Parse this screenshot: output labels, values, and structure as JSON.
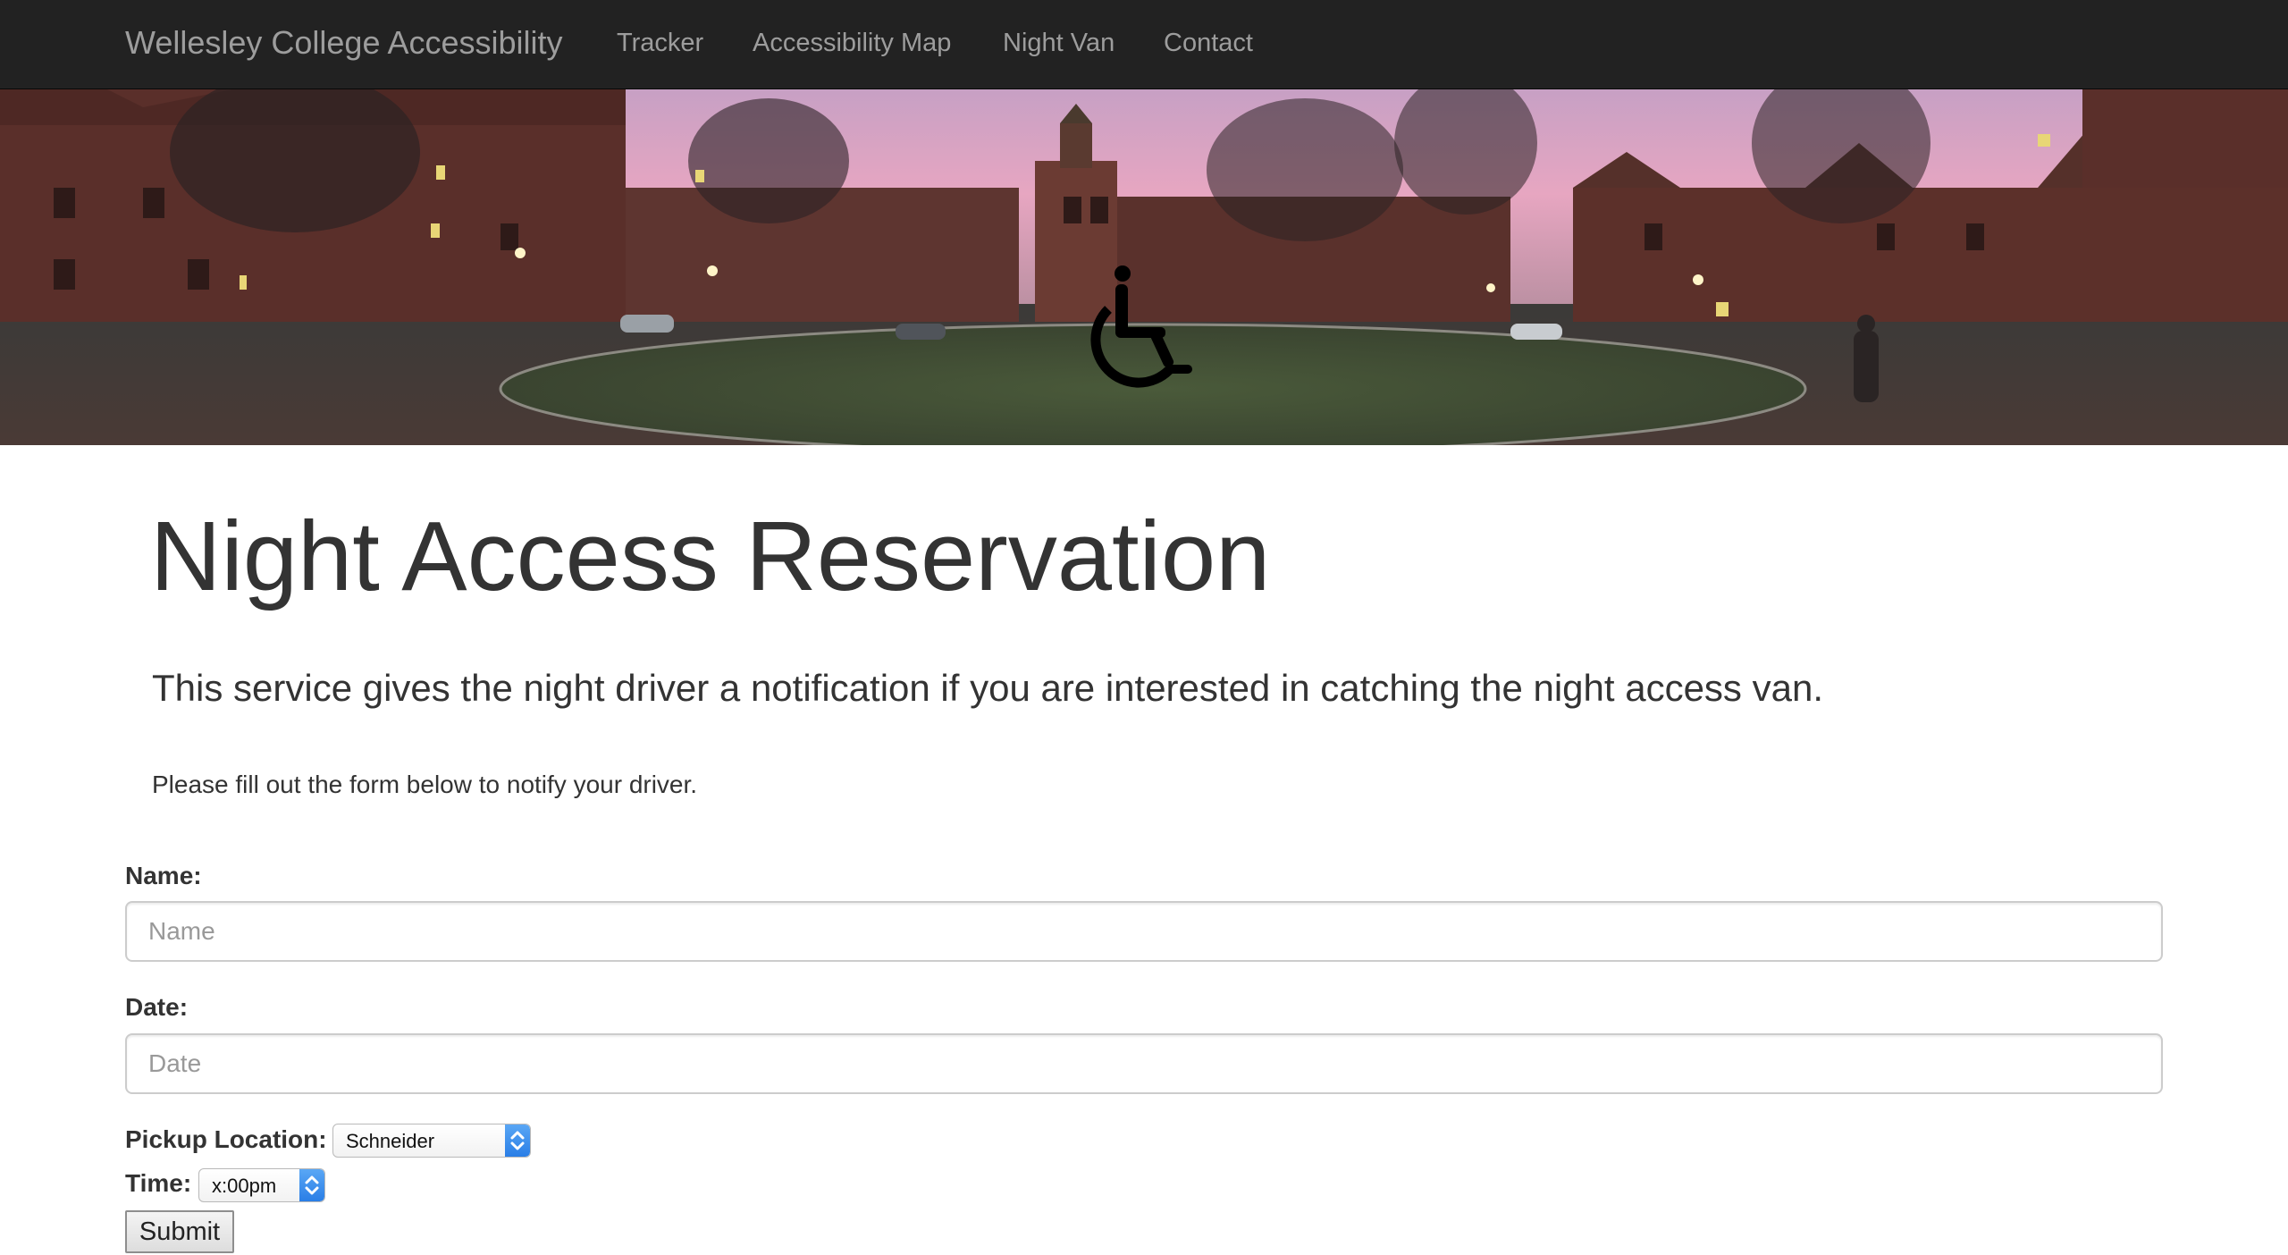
{
  "navbar": {
    "brand": "Wellesley College Accessibility",
    "links": [
      "Tracker",
      "Accessibility Map",
      "Night Van",
      "Contact"
    ]
  },
  "hero": {
    "image_description_icon": "wheelchair-icon"
  },
  "main": {
    "title": "Night Access Reservation",
    "lead": "This service gives the night driver a notification if you are interested in catching the night access van.",
    "instructions": "Please fill out the form below to notify your driver."
  },
  "form": {
    "name": {
      "label": "Name:",
      "placeholder": "Name",
      "value": ""
    },
    "date": {
      "label": "Date:",
      "placeholder": "Date",
      "value": ""
    },
    "pickup": {
      "label": "Pickup Location:",
      "selected": "Schneider"
    },
    "time": {
      "label": "Time:",
      "selected": "x:00pm"
    },
    "submit_label": "Submit"
  },
  "colors": {
    "navbar_bg": "#222222",
    "navbar_text": "#9d9d9d",
    "body_text": "#333333",
    "select_accent": "#2a7ee6"
  }
}
